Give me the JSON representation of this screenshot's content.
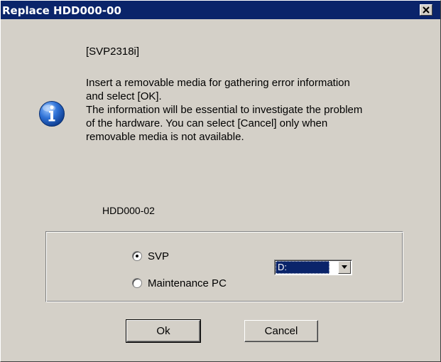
{
  "window": {
    "title": "Replace HDD000-00",
    "close_symbol": "×"
  },
  "message": {
    "icon": "info-icon",
    "code": "[SVP2318i]",
    "lines": [
      "Insert a removable media for gathering error information",
      "and select [OK].",
      "The information will be essential to investigate the problem",
      "of the hardware. You can select [Cancel] only when",
      "removable media is not available."
    ]
  },
  "target": {
    "hdd_label": "HDD000-02"
  },
  "destination": {
    "options": [
      {
        "label": "SVP",
        "checked": true
      },
      {
        "label": "Maintenance PC",
        "checked": false
      }
    ],
    "drive": {
      "selected": "D:"
    }
  },
  "buttons": {
    "ok_label": "Ok",
    "cancel_label": "Cancel"
  },
  "colors": {
    "titlebar": "#0a246a",
    "face": "#d4d0c8",
    "info_icon": "#1f5fbf"
  }
}
